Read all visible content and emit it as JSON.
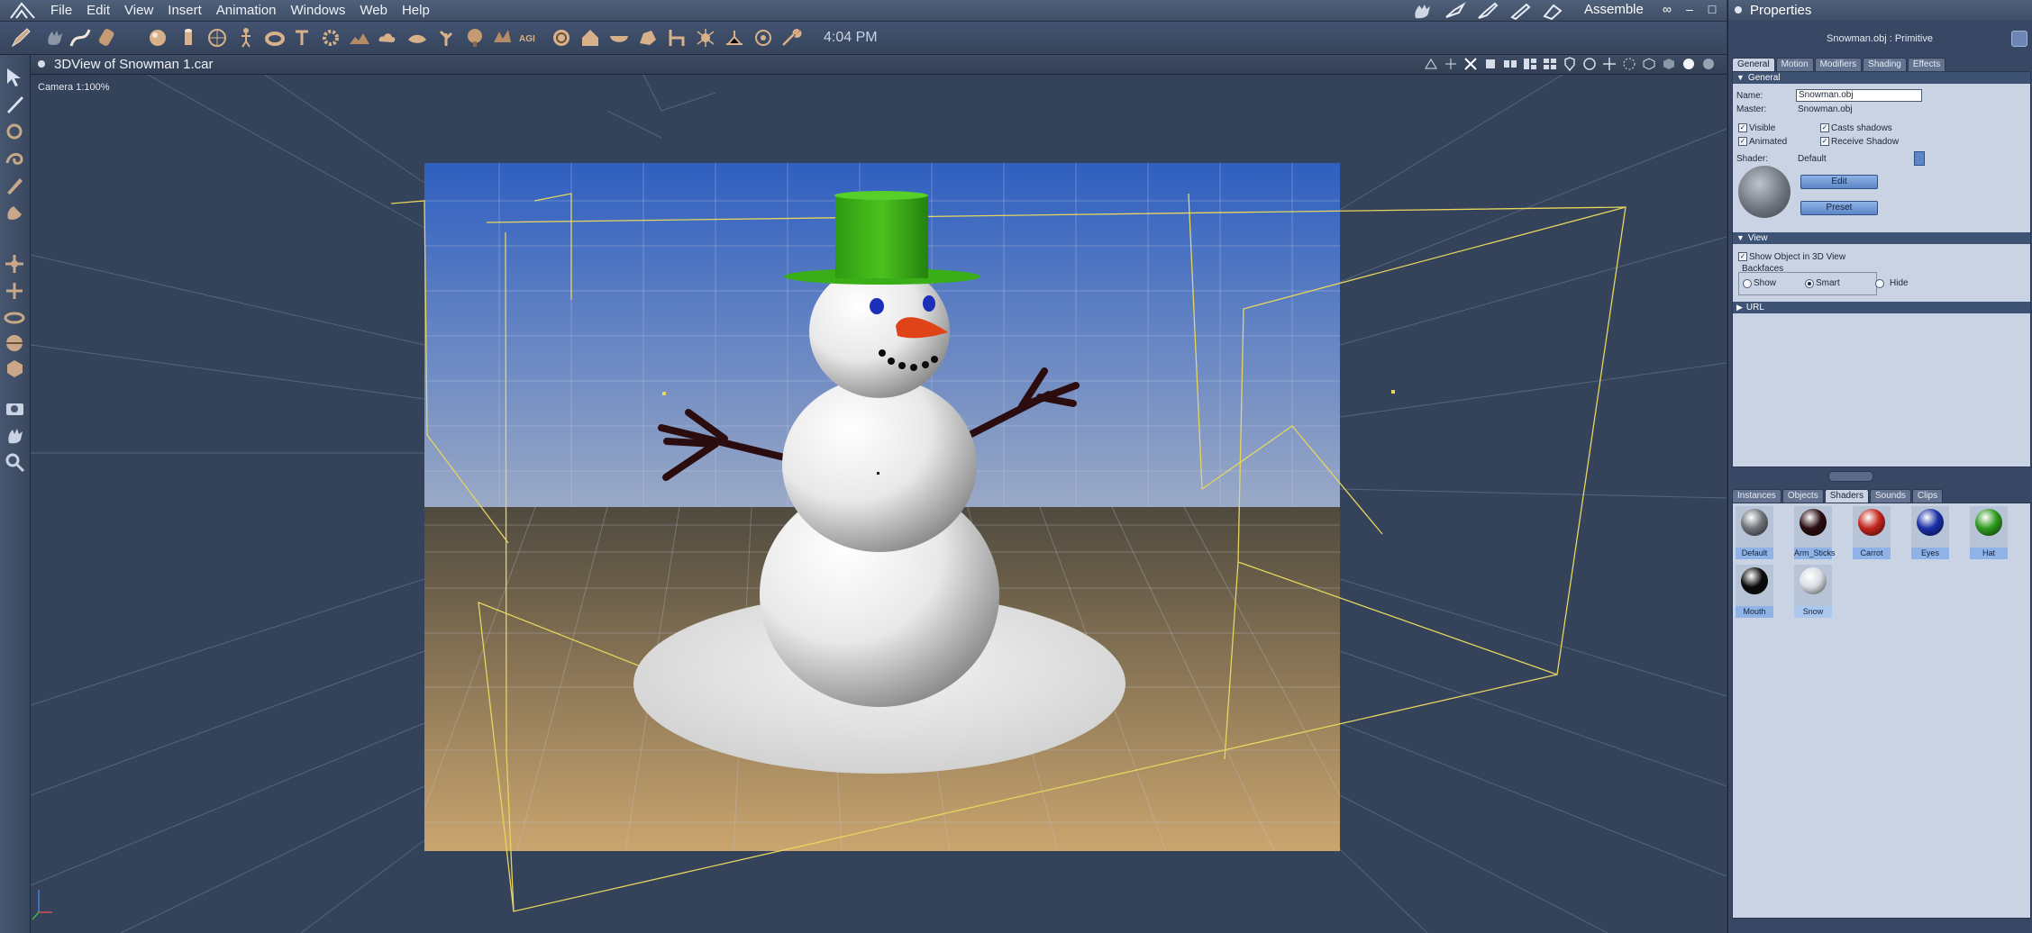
{
  "menubar": {
    "items": [
      "File",
      "Edit",
      "View",
      "Insert",
      "Animation",
      "Windows",
      "Web",
      "Help"
    ],
    "room_label": "Assemble",
    "window_controls": [
      "○○",
      "–",
      "□",
      "×"
    ]
  },
  "toolbar": {
    "clock": "4:04 PM",
    "icons": [
      "pencil-icon",
      "hand-icon",
      "bezier-icon",
      "sculpt-icon",
      "sphere-icon",
      "cylinder-icon",
      "globe-icon",
      "torus-icon",
      "figure-icon",
      "text-icon",
      "gear-icon",
      "terrain-icon",
      "cloud-icon",
      "drop-icon",
      "plant-icon",
      "tree-icon",
      "agi-text-icon",
      "sky-icon",
      "house-icon",
      "bowl-icon",
      "rock-icon",
      "chair-icon",
      "bush-icon",
      "tool-icon",
      "bug-icon",
      "graph-icon",
      "target-icon",
      "wrench-icon"
    ]
  },
  "view": {
    "title": "3DView of Snowman 1.car",
    "camera_label": "Camera 1:100%"
  },
  "left_tools": [
    "select-arrow-icon",
    "direct-select-icon",
    "rotate-icon",
    "twist-icon",
    "brush-icon",
    "hand-link-icon",
    "move-icon",
    "move-plane-icon",
    "orbit-icon",
    "dolly-icon",
    "render-preview-icon",
    "camera-icon",
    "pan-hand-icon",
    "zoom-icon"
  ],
  "properties": {
    "panel_title": "Properties",
    "object_caption": "Snowman.obj : Primitive",
    "tabs": [
      "General",
      "Motion",
      "Modifiers",
      "Shading",
      "Effects"
    ],
    "active_tab": "General",
    "general": {
      "section": "General",
      "name_label": "Name:",
      "name_value": "Snowman.obj",
      "master_label": "Master:",
      "master_value": "Snowman.obj",
      "visible": "Visible",
      "animated": "Animated",
      "casts_shadows": "Casts shadows",
      "receive_shadow": "Receive Shadow",
      "shader_label": "Shader:",
      "shader_value": "Default",
      "edit_button": "Edit",
      "preset_button": "Preset"
    },
    "view_section": {
      "section": "View",
      "show_in_3d": "Show Object in 3D View",
      "backfaces": "Backfaces",
      "show": "Show",
      "smart": "Smart",
      "hide": "Hide",
      "selected": "Smart"
    },
    "url_section": "URL"
  },
  "library": {
    "tabs": [
      "Instances",
      "Objects",
      "Shaders",
      "Sounds",
      "Clips"
    ],
    "active_tab": "Shaders",
    "shaders": [
      {
        "name": "Default",
        "color": "#6f737a"
      },
      {
        "name": "Arm_Sticks",
        "color": "#2b0d10"
      },
      {
        "name": "Carrot",
        "color": "#c2261c"
      },
      {
        "name": "Eyes",
        "color": "#1a2fa8"
      },
      {
        "name": "Hat",
        "color": "#2e9a1e"
      },
      {
        "name": "Mouth",
        "color": "#0b0b0b"
      },
      {
        "name": "Snow",
        "color": "#d9dde3"
      }
    ]
  },
  "scene": {
    "sky_top": "#2f5fc0",
    "sky_bottom": "#9aa9c6",
    "ground_near": "#caa56f",
    "ground_far": "#4f4a3f",
    "hat_color": "#35a812",
    "nose_color": "#e04318",
    "eye_color": "#1c2fb8"
  }
}
